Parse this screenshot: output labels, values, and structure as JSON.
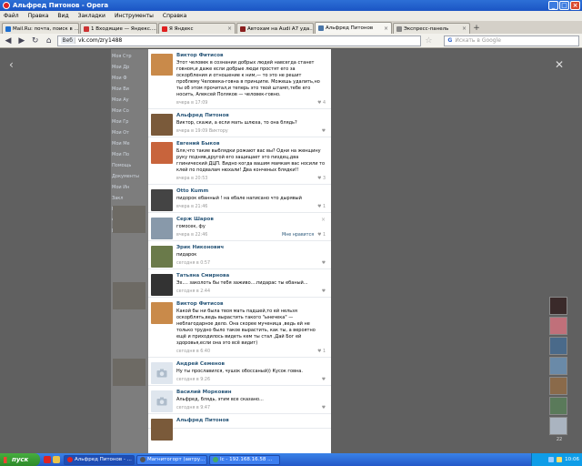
{
  "window": {
    "title": "Альфред Питонов - Opera"
  },
  "menu": [
    "Файл",
    "Правка",
    "Вид",
    "Закладки",
    "Инструменты",
    "Справка"
  ],
  "tabs": [
    {
      "label": "Mail.Ru: почта, поиск в ...",
      "color": "#1e6fd0"
    },
    {
      "label": "1 Входящие — Яндекс....",
      "color": "#cc3333"
    },
    {
      "label": "Я Яндекс",
      "color": "#e02020"
    },
    {
      "label": "Автохам на Audi A7 уда...",
      "color": "#8a1f1f"
    },
    {
      "label": "Альфред Питонов",
      "color": "#4a76a8",
      "active": true
    },
    {
      "label": "Экспресс-панель",
      "color": "#888888"
    }
  ],
  "address": {
    "site_label": "Веб",
    "url": "vk.com/zry1488",
    "search_placeholder": "Искать в Google"
  },
  "leftnav": [
    "Моя Стр",
    "Мои Др",
    "Мои Ф",
    "Мои Ви",
    "Мои Ау",
    "Мои Со",
    "Мои Гр",
    "Мои От",
    "Мои Ме",
    "Мои По",
    "Помощь",
    "Документы",
    "Мои Ин",
    "Закл",
    "Клавиш",
    "Фото",
    "Игры"
  ],
  "comments": [
    {
      "author": "Виктор Фитисов",
      "text": "Этот человек в сознании добрых людей навсегда станет говном,и даже если добрые люди простят его за оскорбления и отношение к ним,— то это не решит проблему Человека-говна в принципе. Можешь удалить,но ты об этом прочитал,и теперь это твой штамп,тебе его носить, Алексей Поляков — человек-говно.",
      "time": "вчера в 17:09",
      "likes": "4",
      "av": "#c98a4a"
    },
    {
      "author": "Альфред Питонов",
      "text": "Виктор, скажи, а если мать шлюха, то она блядь?",
      "time": "вчера в 19:09 Виктору",
      "likes": "",
      "av": "#7a5a3a"
    },
    {
      "author": "Евгений Быков",
      "text": "Бля,что такие выблядки рожают вас вы? Одни на женщину руку подняв,другой его защищает это пиздец,два глинический ДЦП. Видно когда вашим мамкам вас носили то клей по подвалам нюхали! Два конченых блядки!!",
      "time": "вчера в 20:53",
      "likes": "3",
      "av": "#c8643c"
    },
    {
      "author": "Otto Kumm",
      "text": "пидорок ебанный ! на ебале написано что дырявый",
      "time": "вчера в 21:46",
      "likes": "1",
      "av": "#444444"
    },
    {
      "author": "Серж Шаров",
      "text": "гомосек, фу",
      "time": "вчера в 22:46",
      "likes": "1",
      "like_text": "Мне нравится",
      "av": "#8899aa"
    },
    {
      "author": "Эрик Никонович",
      "text": "пидарок",
      "time": "сегодня в 0:57",
      "likes": "",
      "av": "#6a7a4a"
    },
    {
      "author": "Татьяна Смирнова",
      "text": "Эх.... заколоть бы тебя заживо....пидарас ты ебаный...",
      "time": "сегодня в 2:44",
      "likes": "",
      "av": "#333333"
    },
    {
      "author": "Виктор Фитисов",
      "text": "Какой бы ни была твоя мать падшей,то ей нельзя оскорблять,ведь вырастить такого \"ынечека\" — неблагодарное дело. Она скорее мученица ,ведь ей не только трудно было такое вырастить, как ты, а вероятно ещё и приходилось видеть кем ты стал ,Дай Бог ей здоровья,если она это всё видит)",
      "time": "сегодня в 6:40",
      "likes": "1",
      "av": "#c98a4a"
    },
    {
      "author": "Андрей Семенов",
      "text": "Ну ты прославился, чушок обоссаный)) Кусок говна.",
      "time": "сегодня в 9:26",
      "likes": "",
      "av": "camera"
    },
    {
      "author": "Василий Морковин",
      "text": "Альфред, блядь, этим все сказано...",
      "time": "сегодня в 9:47",
      "likes": "",
      "av": "camera"
    },
    {
      "author": "Альфред Питонов",
      "text": "",
      "time": "",
      "likes": "",
      "av": "#7a5a3a"
    }
  ],
  "right_avatars": [
    "#3a2a2a",
    "#c0707a",
    "#4a6a8a",
    "#6a8aa8",
    "#8a6a4a",
    "#5a7a5a",
    "#aab4c0"
  ],
  "right_count": "22",
  "taskbar": {
    "start": "пуск",
    "tasks": [
      {
        "label": "Альфред Питонов - ...",
        "color": "#d22",
        "active": true
      },
      {
        "label": "Магнитогорт (автру...",
        "color": "#555"
      },
      {
        "label": "Ic - 192.168.16.58 ...",
        "color": "#4a6"
      }
    ],
    "clock": "10:06"
  }
}
